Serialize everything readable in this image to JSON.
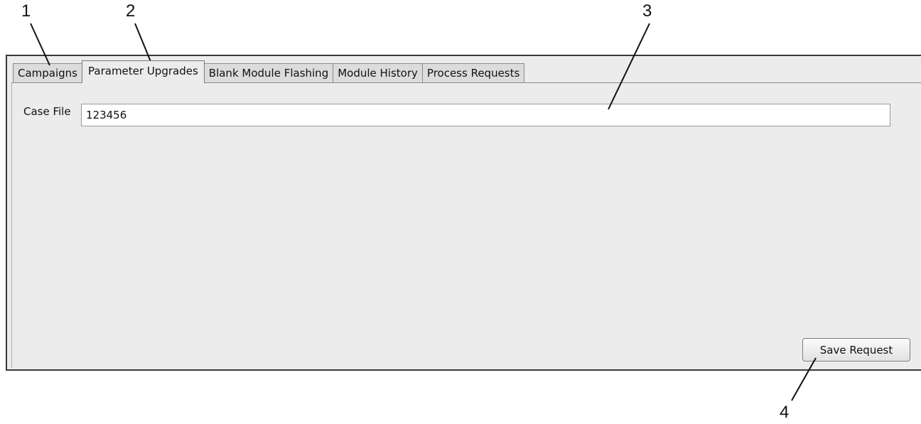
{
  "callouts": {
    "one": "1",
    "two": "2",
    "three": "3",
    "four": "4"
  },
  "tabs": [
    {
      "label": "Campaigns",
      "active": false
    },
    {
      "label": "Parameter Upgrades",
      "active": true
    },
    {
      "label": "Blank Module Flashing",
      "active": false
    },
    {
      "label": "Module History",
      "active": false
    },
    {
      "label": "Process Requests",
      "active": false
    }
  ],
  "form": {
    "case_file_label": "Case File",
    "case_file_value": "123456"
  },
  "actions": {
    "save_label": "Save Request"
  }
}
